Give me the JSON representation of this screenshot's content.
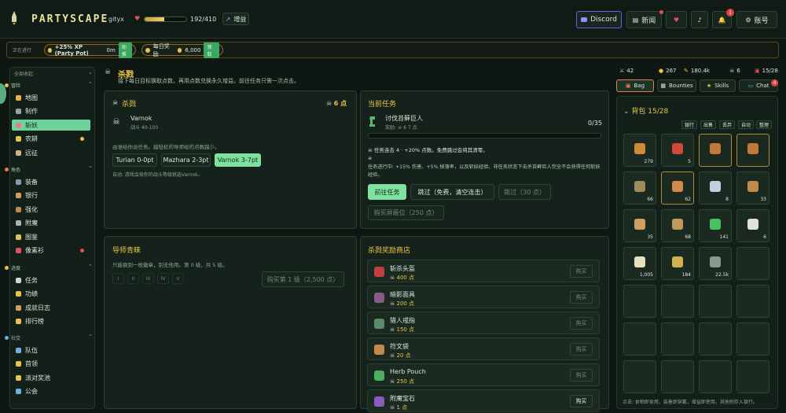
{
  "topbar": {
    "logo": "PARTYSCAPE",
    "username": "gityx",
    "hp": "192/410",
    "hp_fraction": 0.47,
    "boost_label": "增益",
    "discord_label": "Discord",
    "news_label": "新闻",
    "account_label": "账号",
    "notif_badge": "1"
  },
  "buffs": {
    "label": "正在进行",
    "buff1": "+25% XP (Party Pot)",
    "buff1_time": "0m",
    "buff1_btn": "助推",
    "buff2": "每日奖励",
    "buff2_amount": "6,000",
    "buff2_btn": "领取"
  },
  "sidebar": {
    "collapse_label": "全部收起",
    "sections": [
      {
        "label": "冒险",
        "items": [
          "地图",
          "制作",
          "斩妖",
          "农耕",
          "远征"
        ]
      },
      {
        "label": "角色",
        "items": [
          "装备",
          "银行",
          "强化",
          "附魔",
          "图鉴",
          "像素衫"
        ]
      },
      {
        "label": "进度",
        "items": [
          "任务",
          "功绩",
          "成就日志",
          "排行榜"
        ]
      },
      {
        "label": "社交",
        "items": [
          "队伍",
          "首领",
          "派对奖池",
          "公会"
        ]
      }
    ]
  },
  "page": {
    "title": "杀戮",
    "subtitle": "接下每日目标换取点数。再用点数兑换永久增益。前往任务只需一次点击。"
  },
  "slayer_card": {
    "title": "杀戮",
    "points": "6 点",
    "master_name": "Varnok",
    "master_range": "战斗 40-100",
    "desc": "由谁给你派任务。越轻松的导师给的点数越少。",
    "options": [
      "Turian 0-0pt",
      "Mazhara 2-3pt",
      "Varnok 3-7pt"
    ],
    "auto_note": "自动: 游戏会按你的战斗等级挑选Varnok。"
  },
  "task_card": {
    "title": "当前任务",
    "task_name": "讨伐苔藓巨人",
    "reward": "奖励:",
    "reward_points": "6 7 点",
    "progress": "0/35",
    "progress_fraction": 0.0,
    "line1": "任务连击 4 · +20% 点数。免费跳过会将其清零。",
    "line2": "任务进行中: +15% 伤害、+5% 掉落率，以及斩妖经验。非任务状态下击杀苔藓巨人完全不会获得任何斩妖经验。",
    "go_btn": "前往任务",
    "skip_free_btn": "跳过（免费，清空连击）",
    "skip_paid_btn": "跳过（30 点）",
    "buy_block_btn": "购买屏蔽位（250 点）"
  },
  "mentor_card": {
    "title": "导师青睐",
    "desc": "只能换到一枚徽章，别无他用。第 0 级，共 5 级。",
    "tiers": [
      "I",
      "II",
      "III",
      "IV",
      "V"
    ],
    "buy_btn": "购买第 1 级（2,500 点）"
  },
  "shop": {
    "title": "杀戮奖励商店",
    "buy_label": "购买",
    "items": [
      {
        "name": "斩杀头盔",
        "price": "400 点"
      },
      {
        "name": "暗影面具",
        "price": "200 点"
      },
      {
        "name": "猎人戒指",
        "price": "150 点"
      },
      {
        "name": "符文袋",
        "price": "20 点"
      },
      {
        "name": "Herb Pouch",
        "price": "250 点"
      },
      {
        "name": "附魔宝石",
        "price": "1 点"
      }
    ]
  },
  "stats": [
    {
      "icon": "swords-icon",
      "value": "42"
    },
    {
      "icon": "coin-icon",
      "value": "267"
    },
    {
      "icon": "feather-icon",
      "value": "180.4k"
    },
    {
      "icon": "skull-icon",
      "value": "6"
    },
    {
      "icon": "bag-icon",
      "value": "15/28"
    }
  ],
  "right_tabs": {
    "bag": "Bag",
    "bounties": "Bounties",
    "skills": "Skills",
    "chat": "Chat",
    "chat_badge": "4"
  },
  "bag": {
    "title": "背包 15/28",
    "actions": [
      "银行",
      "出售",
      "丢弃",
      "自动",
      "整理"
    ],
    "slots": [
      {
        "qty": "279",
        "color": "#d08a3a"
      },
      {
        "qty": "5",
        "color": "#d04a3a"
      },
      {
        "qty": "",
        "color": "#c07a3a"
      },
      {
        "qty": "",
        "color": "#c07a3a"
      },
      {
        "qty": "66",
        "color": "#a08a5a"
      },
      {
        "qty": "62",
        "color": "#d08a4a"
      },
      {
        "qty": "8",
        "color": "#c0d0e0"
      },
      {
        "qty": "33",
        "color": "#c08a4a"
      },
      {
        "qty": "35",
        "color": "#d0a060"
      },
      {
        "qty": "68",
        "color": "#c09a5a"
      },
      {
        "qty": "141",
        "color": "#4ac060"
      },
      {
        "qty": "6",
        "color": "#e0e0e0"
      },
      {
        "qty": "1,005",
        "color": "#e8e0c0"
      },
      {
        "qty": "184",
        "color": "#d0b050"
      },
      {
        "qty": "22.5k",
        "color": "#8a9a8a"
      }
    ],
    "hint": "点击: 食物即食用，装备即穿戴，增益即使用。其他则存入银行。"
  }
}
